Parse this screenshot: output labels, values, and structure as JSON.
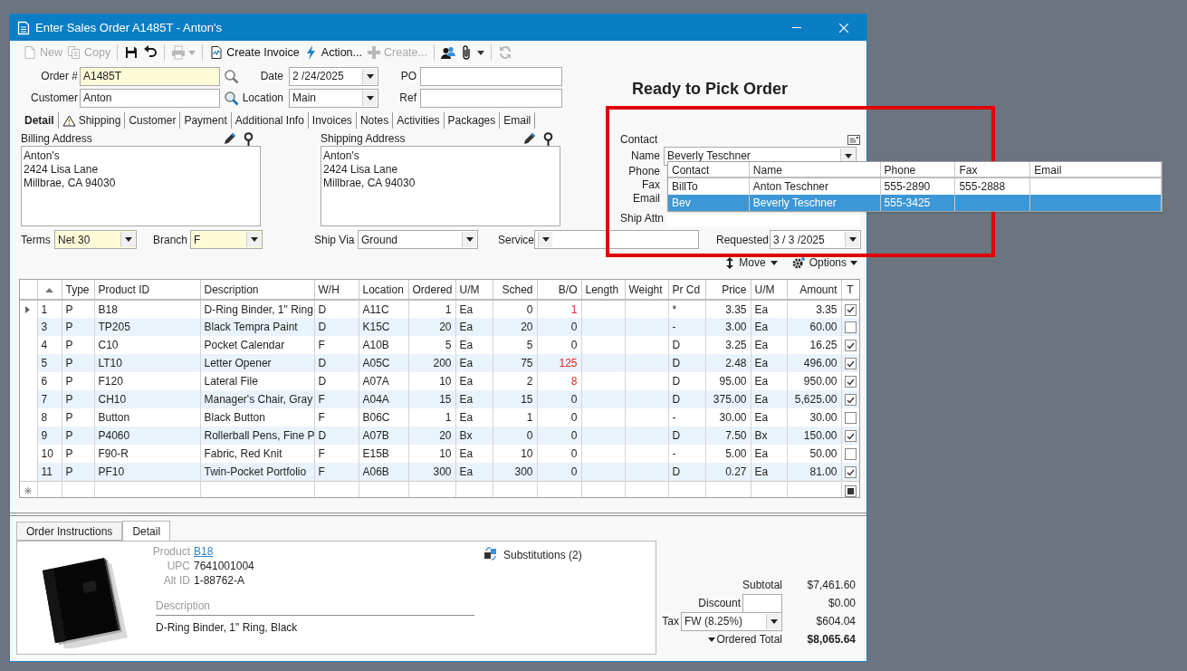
{
  "window": {
    "title": "Enter Sales Order A1485T - Anton's"
  },
  "toolbar_groups": [
    {
      "items": [
        {
          "kind": "new",
          "label": "New",
          "disabled": true,
          "menu": false
        },
        {
          "kind": "copy",
          "label": "Copy",
          "disabled": true,
          "menu": false
        }
      ]
    },
    {
      "items": [
        {
          "kind": "save",
          "disabled": false,
          "menu": false
        },
        {
          "kind": "undo",
          "disabled": false,
          "menu": false
        }
      ]
    },
    {
      "items": [
        {
          "kind": "print",
          "disabled": true,
          "menu": true
        }
      ]
    },
    {
      "items": [
        {
          "kind": "invoice",
          "label": "Create Invoice",
          "disabled": false,
          "menu": false
        },
        {
          "kind": "lightning",
          "label": "Action...",
          "disabled": false,
          "menu": false
        },
        {
          "kind": "plus",
          "label": "Create...",
          "disabled": true,
          "menu": false
        }
      ]
    },
    {
      "items": [
        {
          "kind": "contacts",
          "disabled": false,
          "menu": false
        },
        {
          "kind": "paperclip",
          "disabled": false,
          "menu": true
        }
      ]
    },
    {
      "items": [
        {
          "kind": "refresh",
          "disabled": true,
          "menu": false
        }
      ]
    }
  ],
  "order": {
    "label": "Order #",
    "value": "A1485T",
    "highlighted": true
  },
  "customer": {
    "label": "Customer",
    "value": "Anton",
    "highlighted": false
  },
  "date": {
    "label": "Date",
    "value": "2 /24/2025"
  },
  "location": {
    "label": "Location",
    "value": "Main"
  },
  "po": {
    "label": "PO"
  },
  "ref": {
    "label": "Ref"
  },
  "status_title": "Ready to Pick Order",
  "tabs": [
    {
      "label": "Detail",
      "selected": true,
      "warning": false
    },
    {
      "label": "Shipping",
      "selected": false,
      "warning": true
    },
    {
      "label": "Customer",
      "selected": false,
      "warning": false
    },
    {
      "label": "Payment",
      "selected": false,
      "warning": false
    },
    {
      "label": "Additional Info",
      "selected": false,
      "warning": false
    },
    {
      "label": "Invoices",
      "selected": false,
      "warning": false
    },
    {
      "label": "Notes",
      "selected": false,
      "warning": false
    },
    {
      "label": "Activities",
      "selected": false,
      "warning": false
    },
    {
      "label": "Packages",
      "selected": false,
      "warning": false
    },
    {
      "label": "Email",
      "selected": false,
      "warning": false
    }
  ],
  "billing_address": {
    "label": "Billing Address",
    "lines": [
      "Anton's",
      "2424 Lisa Lane",
      "Millbrae, CA 94030"
    ]
  },
  "shipping_address": {
    "label": "Shipping Address",
    "lines": [
      "Anton's",
      "2424 Lisa Lane",
      "Millbrae, CA 94030"
    ]
  },
  "contact": {
    "title": "Contact",
    "name_label": "Name",
    "name_value": "Beverly Teschner",
    "field_labels": [
      "Phone",
      "Fax",
      "Email"
    ],
    "ship_attn_label": "Ship Attn"
  },
  "contact_dropdown": {
    "columns": [
      "Contact",
      "Name",
      "Phone",
      "Fax",
      "Email"
    ],
    "rows": [
      {
        "contact": "BillTo",
        "name": "Anton Teschner",
        "phone": "555-2890",
        "fax": "555-2888",
        "selected": false
      },
      {
        "contact": "Bev",
        "name": "Beverly Teschner",
        "phone": "555-3425",
        "selected": true
      }
    ]
  },
  "terms": {
    "label": "Terms",
    "value": "Net 30",
    "highlighted": true
  },
  "branch": {
    "label": "Branch",
    "value": "F",
    "highlighted": true
  },
  "ship_via": {
    "label": "Ship Via",
    "value": "Ground"
  },
  "service": {
    "label": "Service"
  },
  "requested": {
    "label": "Requested",
    "value": "3 / 3 /2025"
  },
  "grid_actions": {
    "move": "Move",
    "options": "Options"
  },
  "table": {
    "new_row": {
      "taxable_indeterminate": true
    },
    "columns": [
      "Type",
      "Product ID",
      "Description",
      "W/H",
      "Location",
      "Ordered",
      "U/M",
      "Sched",
      "B/O",
      "Length",
      "Weight",
      "Pr Cd",
      "Price",
      "U/M",
      "Amount",
      "T"
    ],
    "rows": [
      {
        "current": true,
        "line": "1",
        "type": "P",
        "product_id": "B18",
        "description": "D-Ring Binder, 1\" Ring",
        "wh": "D",
        "location": "A11C",
        "ordered": "1",
        "um": "Ea",
        "sched": "0",
        "bo": "1",
        "backordered": true,
        "pr_cd": "*",
        "price": "3.35",
        "price_um": "Ea",
        "amount": "3.35",
        "taxable": true
      },
      {
        "current": false,
        "line": "3",
        "type": "P",
        "product_id": "TP205",
        "description": "Black Tempra Paint",
        "wh": "D",
        "location": "K15C",
        "ordered": "20",
        "um": "Ea",
        "sched": "20",
        "bo": "0",
        "backordered": false,
        "pr_cd": "-",
        "price": "3.00",
        "price_um": "Ea",
        "amount": "60.00",
        "taxable": false
      },
      {
        "current": false,
        "line": "4",
        "type": "P",
        "product_id": "C10",
        "description": "Pocket Calendar",
        "wh": "F",
        "location": "A10B",
        "ordered": "5",
        "um": "Ea",
        "sched": "5",
        "bo": "0",
        "backordered": false,
        "pr_cd": "D",
        "price": "3.25",
        "price_um": "Ea",
        "amount": "16.25",
        "taxable": true
      },
      {
        "current": false,
        "line": "5",
        "type": "P",
        "product_id": "LT10",
        "description": "Letter Opener",
        "wh": "D",
        "location": "A05C",
        "ordered": "200",
        "um": "Ea",
        "sched": "75",
        "bo": "125",
        "backordered": true,
        "pr_cd": "D",
        "price": "2.48",
        "price_um": "Ea",
        "amount": "496.00",
        "taxable": true
      },
      {
        "current": false,
        "line": "6",
        "type": "P",
        "product_id": "F120",
        "description": "Lateral File",
        "wh": "D",
        "location": "A07A",
        "ordered": "10",
        "um": "Ea",
        "sched": "2",
        "bo": "8",
        "backordered": true,
        "pr_cd": "D",
        "price": "95.00",
        "price_um": "Ea",
        "amount": "950.00",
        "taxable": true
      },
      {
        "current": false,
        "line": "7",
        "type": "P",
        "product_id": "CH10",
        "description": "Manager's Chair, Gray",
        "wh": "F",
        "location": "A04A",
        "ordered": "15",
        "um": "Ea",
        "sched": "15",
        "bo": "0",
        "backordered": false,
        "pr_cd": "D",
        "price": "375.00",
        "price_um": "Ea",
        "amount": "5,625.00",
        "taxable": true
      },
      {
        "current": false,
        "line": "8",
        "type": "P",
        "product_id": "Button",
        "description": "Black Button",
        "wh": "F",
        "location": "B06C",
        "ordered": "1",
        "um": "Ea",
        "sched": "1",
        "bo": "0",
        "backordered": false,
        "pr_cd": "-",
        "price": "30.00",
        "price_um": "Ea",
        "amount": "30.00",
        "taxable": false
      },
      {
        "current": false,
        "line": "9",
        "type": "P",
        "product_id": "P4060",
        "description": "Rollerball Pens, Fine P",
        "wh": "D",
        "location": "A07B",
        "ordered": "20",
        "um": "Bx",
        "sched": "0",
        "bo": "0",
        "backordered": false,
        "pr_cd": "D",
        "price": "7.50",
        "price_um": "Bx",
        "amount": "150.00",
        "taxable": true
      },
      {
        "current": false,
        "line": "10",
        "type": "P",
        "product_id": "F90-R",
        "description": "Fabric, Red Knit",
        "wh": "F",
        "location": "E15B",
        "ordered": "10",
        "um": "Ea",
        "sched": "10",
        "bo": "0",
        "backordered": false,
        "pr_cd": "-",
        "price": "5.00",
        "price_um": "Ea",
        "amount": "50.00",
        "taxable": false
      },
      {
        "current": false,
        "line": "11",
        "type": "P",
        "product_id": "PF10",
        "description": "Twin-Pocket Portfolio",
        "wh": "F",
        "location": "A06B",
        "ordered": "300",
        "um": "Ea",
        "sched": "300",
        "bo": "0",
        "backordered": false,
        "pr_cd": "D",
        "price": "0.27",
        "price_um": "Ea",
        "amount": "81.00",
        "taxable": true
      }
    ]
  },
  "bottom_tabs": [
    {
      "label": "Order Instructions",
      "selected": false
    },
    {
      "label": "Detail",
      "selected": true
    }
  ],
  "detail": {
    "product_label": "Product",
    "product": "B18",
    "upc_label": "UPC",
    "upc": "7641001004",
    "alt_id_label": "Alt ID",
    "alt_id": "1-88762-A",
    "description_label": "Description",
    "description": "D-Ring Binder, 1\" Ring, Black",
    "substitutions": "Substitutions (2)"
  },
  "totals": {
    "subtotal_label": "Subtotal",
    "subtotal": "$7,461.60",
    "discount_label": "Discount",
    "discount": "$0.00",
    "tax_label": "Tax",
    "tax_code": "FW (8.25%)",
    "tax": "$604.04",
    "total_label": "Ordered Total",
    "total": "$8,065.64"
  }
}
